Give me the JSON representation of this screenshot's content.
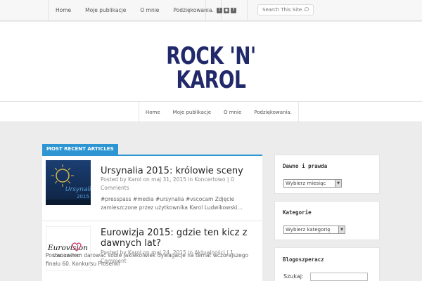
{
  "top_nav": {
    "items": [
      "Home",
      "Moje publikacje",
      "O mnie",
      "Podziękowania."
    ],
    "search_placeholder": "Search This Site..."
  },
  "social_icons": [
    "twitter-icon",
    "rss-icon",
    "facebook-icon"
  ],
  "logo": {
    "text": "ROCK 'N' KAROL",
    "color": "#21296b"
  },
  "main_nav": {
    "items": [
      "Home",
      "Moje publikacje",
      "O mnie",
      "Podziękowania."
    ]
  },
  "section_tab": {
    "label": "MOST RECENT ARTICLES",
    "color": "#2e95d3"
  },
  "articles": [
    {
      "title": "Ursynalia 2015: królowie sceny",
      "meta_prefix": "Posted by ",
      "author": "Karol",
      "meta_on": " on ",
      "date": "maj 31, 2015",
      "meta_in": " in ",
      "category": "Koncertowo",
      "meta_sep": " | ",
      "comments": "0 Comments",
      "excerpt": "#presspass #media #ursynalia #vscocam Zdjęcie zamieszczone przez użytkownika Karol Ludwikowski..."
    },
    {
      "title": "Eurowizja 2015: gdzie ten kicz z dawnych lat?",
      "meta_prefix": "Posted by ",
      "author": "Karol",
      "meta_on": " on ",
      "date": "maj 24, 2015",
      "meta_in": " in ",
      "category": "Aktualności",
      "meta_sep": " | ",
      "comments": "1 Comment",
      "excerpt": "Postanowiłem darować sobie jakiekolwiek dywagacje na temat wczorajszego finału 60. Konkursu Piosenki"
    }
  ],
  "thumbnails": {
    "ursynalia_text": "Ursynalia",
    "ursynalia_year": "2015",
    "eurovision_text": "Eurovision",
    "eurovision_sub": "SONG CONTEST"
  },
  "sidebar": {
    "archive_title": "Dawno i prawda",
    "archive_select": "Wybierz miesiąc",
    "categories_title": "Kategorie",
    "categories_select": "Wybierz kategorię",
    "blog_title": "Blogoszperacz",
    "search_label": "Szukaj:"
  }
}
